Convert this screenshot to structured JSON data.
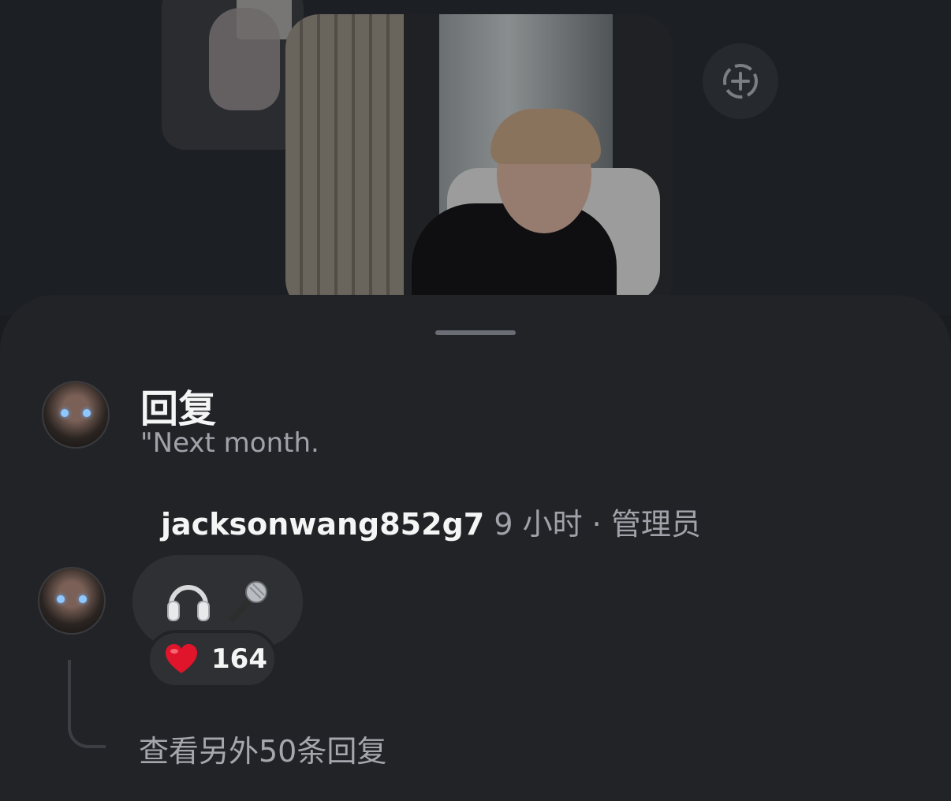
{
  "header": {
    "add_button_icon": "add-circle-dashed-icon"
  },
  "sheet": {
    "title": "回复",
    "quoted_text": "\"Next month.",
    "comment": {
      "username": "jacksonwang852g7",
      "time": "9 小时",
      "separator": "·",
      "role": "管理员",
      "message_icons": [
        "headphones-icon",
        "microphone-icon"
      ],
      "reaction": {
        "icon": "heart-icon",
        "count": "164"
      }
    },
    "view_more": "查看另外50条回复"
  },
  "colors": {
    "sheet_bg": "#222327",
    "page_bg": "#1a1c20",
    "bubble_bg": "#2e3034",
    "secondary_text": "#9fa3a9",
    "heart": "#e0142b"
  }
}
